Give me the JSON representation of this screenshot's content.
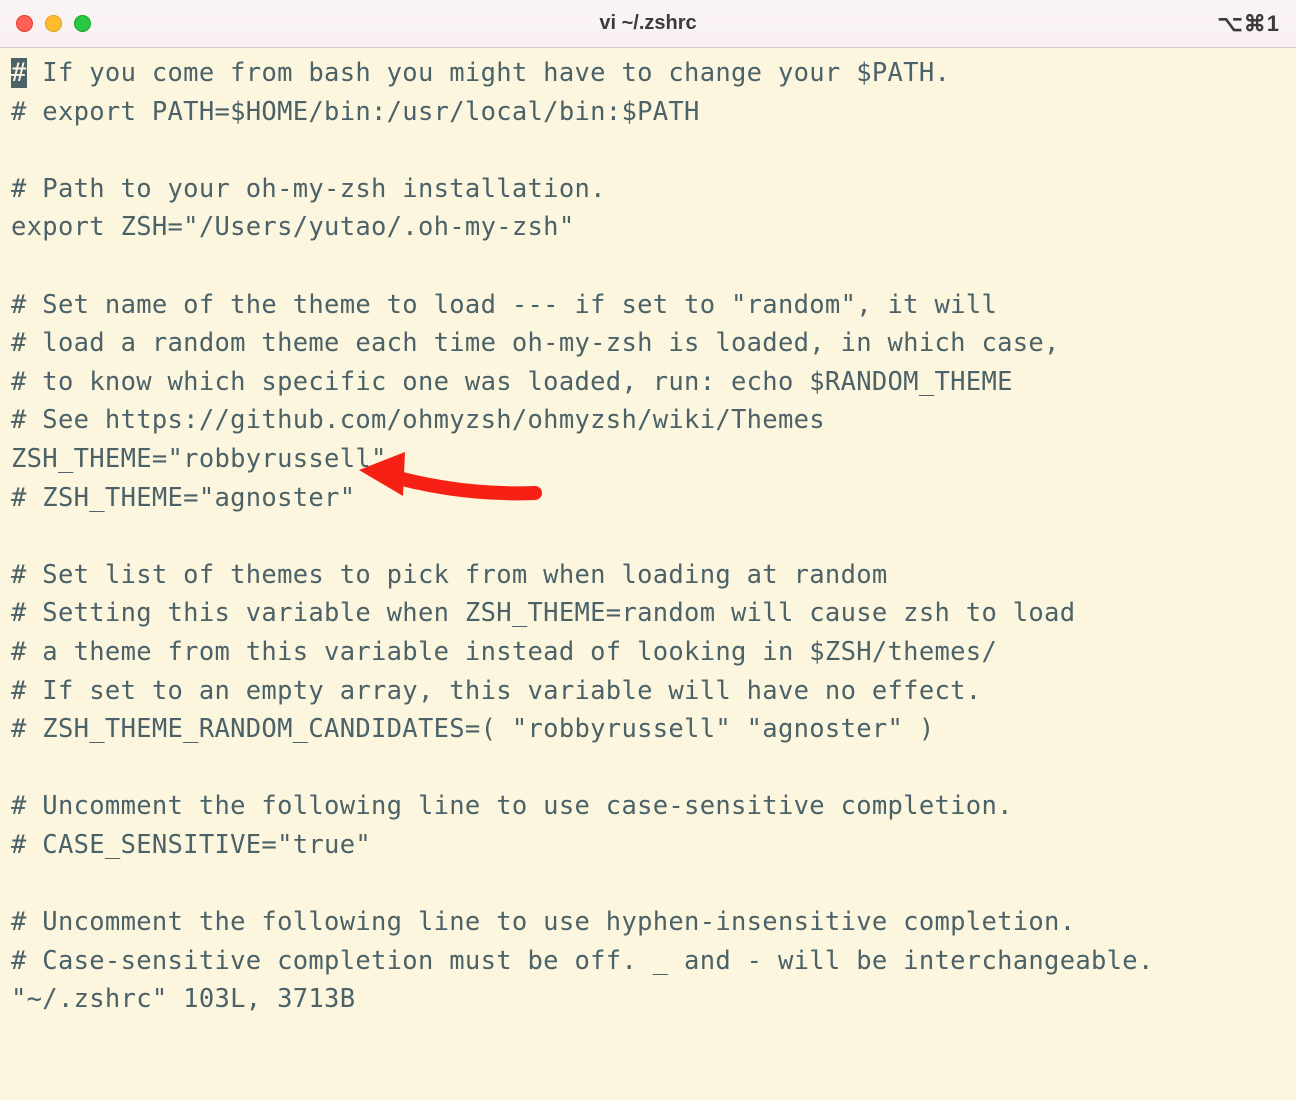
{
  "window": {
    "title": "vi ~/.zshrc",
    "shortcut": "⌥⌘1"
  },
  "editor": {
    "lines": [
      "# If you come from bash you might have to change your $PATH.",
      "# export PATH=$HOME/bin:/usr/local/bin:$PATH",
      "",
      "# Path to your oh-my-zsh installation.",
      "export ZSH=\"/Users/yutao/.oh-my-zsh\"",
      "",
      "# Set name of the theme to load --- if set to \"random\", it will",
      "# load a random theme each time oh-my-zsh is loaded, in which case,",
      "# to know which specific one was loaded, run: echo $RANDOM_THEME",
      "# See https://github.com/ohmyzsh/ohmyzsh/wiki/Themes",
      "ZSH_THEME=\"robbyrussell\"",
      "# ZSH_THEME=\"agnoster\"",
      "",
      "# Set list of themes to pick from when loading at random",
      "# Setting this variable when ZSH_THEME=random will cause zsh to load",
      "# a theme from this variable instead of looking in $ZSH/themes/",
      "# If set to an empty array, this variable will have no effect.",
      "# ZSH_THEME_RANDOM_CANDIDATES=( \"robbyrussell\" \"agnoster\" )",
      "",
      "# Uncomment the following line to use case-sensitive completion.",
      "# CASE_SENSITIVE=\"true\"",
      "",
      "# Uncomment the following line to use hyphen-insensitive completion.",
      "# Case-sensitive completion must be off. _ and - will be interchangeable.",
      "\"~/.zshrc\" 103L, 3713B"
    ],
    "cursor_line": 0,
    "cursor_col": 0,
    "status": "\"~/.zshrc\" 103L, 3713B"
  },
  "annotation": {
    "type": "arrow",
    "points_to_line": 10,
    "color": "#f62015"
  }
}
